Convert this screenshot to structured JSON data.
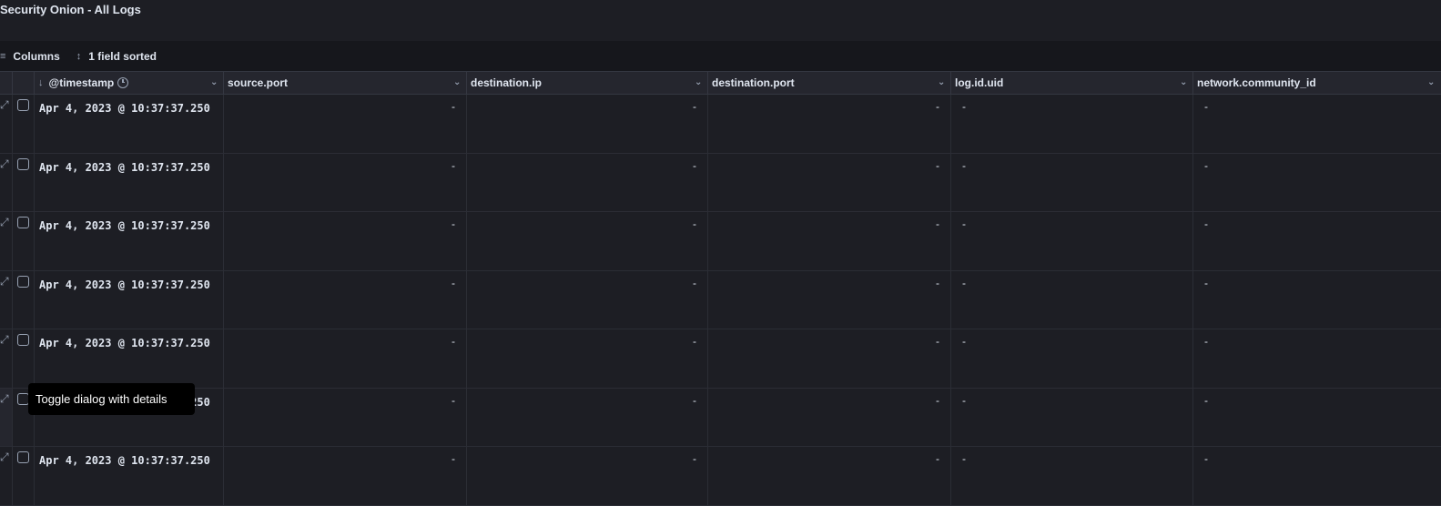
{
  "window": {
    "title": "Security Onion - All Logs"
  },
  "toolbar": {
    "columns_label": "Columns",
    "columns_icon": "list-columns-icon",
    "sort_label": "1 field sorted",
    "sort_icon": "sort-updown-icon"
  },
  "table": {
    "columns": [
      {
        "label": "@timestamp",
        "sort": "descending"
      },
      {
        "label": "source.port"
      },
      {
        "label": "destination.ip"
      },
      {
        "label": "destination.port"
      },
      {
        "label": "log.id.uid"
      },
      {
        "label": "network.community_id"
      }
    ],
    "rows": [
      {
        "timestamp": "Apr 4, 2023 @ 10:37:37.250",
        "source_port": "-",
        "destination_ip": "-",
        "destination_port": "-",
        "log_id_uid": "-",
        "network_community_id": "-"
      },
      {
        "timestamp": "Apr 4, 2023 @ 10:37:37.250",
        "source_port": "-",
        "destination_ip": "-",
        "destination_port": "-",
        "log_id_uid": "-",
        "network_community_id": "-"
      },
      {
        "timestamp": "Apr 4, 2023 @ 10:37:37.250",
        "source_port": "-",
        "destination_ip": "-",
        "destination_port": "-",
        "log_id_uid": "-",
        "network_community_id": "-"
      },
      {
        "timestamp": "Apr 4, 2023 @ 10:37:37.250",
        "source_port": "-",
        "destination_ip": "-",
        "destination_port": "-",
        "log_id_uid": "-",
        "network_community_id": "-"
      },
      {
        "timestamp": "Apr 4, 2023 @ 10:37:37.250",
        "source_port": "-",
        "destination_ip": "-",
        "destination_port": "-",
        "log_id_uid": "-",
        "network_community_id": "-"
      },
      {
        "timestamp": "Apr 4, 2023 @ 10:37:37.250",
        "source_port": "-",
        "destination_ip": "-",
        "destination_port": "-",
        "log_id_uid": "-",
        "network_community_id": "-"
      },
      {
        "timestamp": "Apr 4, 2023 @ 10:37:37.250",
        "source_port": "-",
        "destination_ip": "-",
        "destination_port": "-",
        "log_id_uid": "-",
        "network_community_id": "-"
      }
    ]
  },
  "tooltip": {
    "text": "Toggle dialog with details"
  }
}
